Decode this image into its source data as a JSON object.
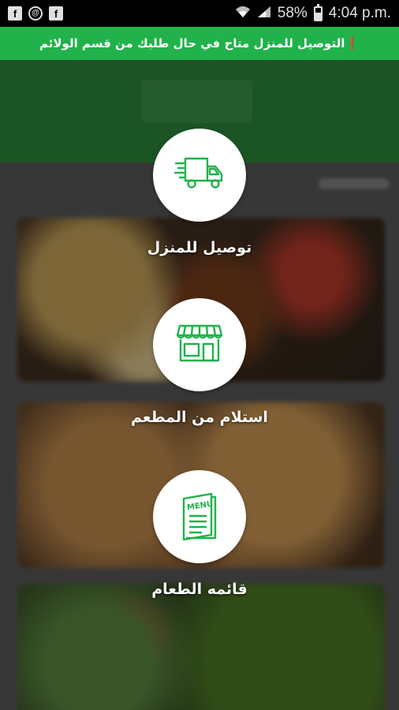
{
  "status_bar": {
    "left_icons": [
      "facebook-icon",
      "sync-icon",
      "facebook-icon"
    ],
    "battery_percent": "58%",
    "time": "4:04 p.m."
  },
  "banner": {
    "text": "❗التوصيل للمنزل متاح في حال طلبك من قسم الولائم",
    "color": "#21b24b"
  },
  "options": [
    {
      "label": "توصيل للمنزل",
      "icon": "delivery-truck-icon"
    },
    {
      "label": "استلام من المطعم",
      "icon": "storefront-icon"
    },
    {
      "label": "قائمه الطعام",
      "icon": "menu-icon",
      "icon_text": "MENU"
    }
  ],
  "theme": {
    "accent": "#21b24b"
  }
}
